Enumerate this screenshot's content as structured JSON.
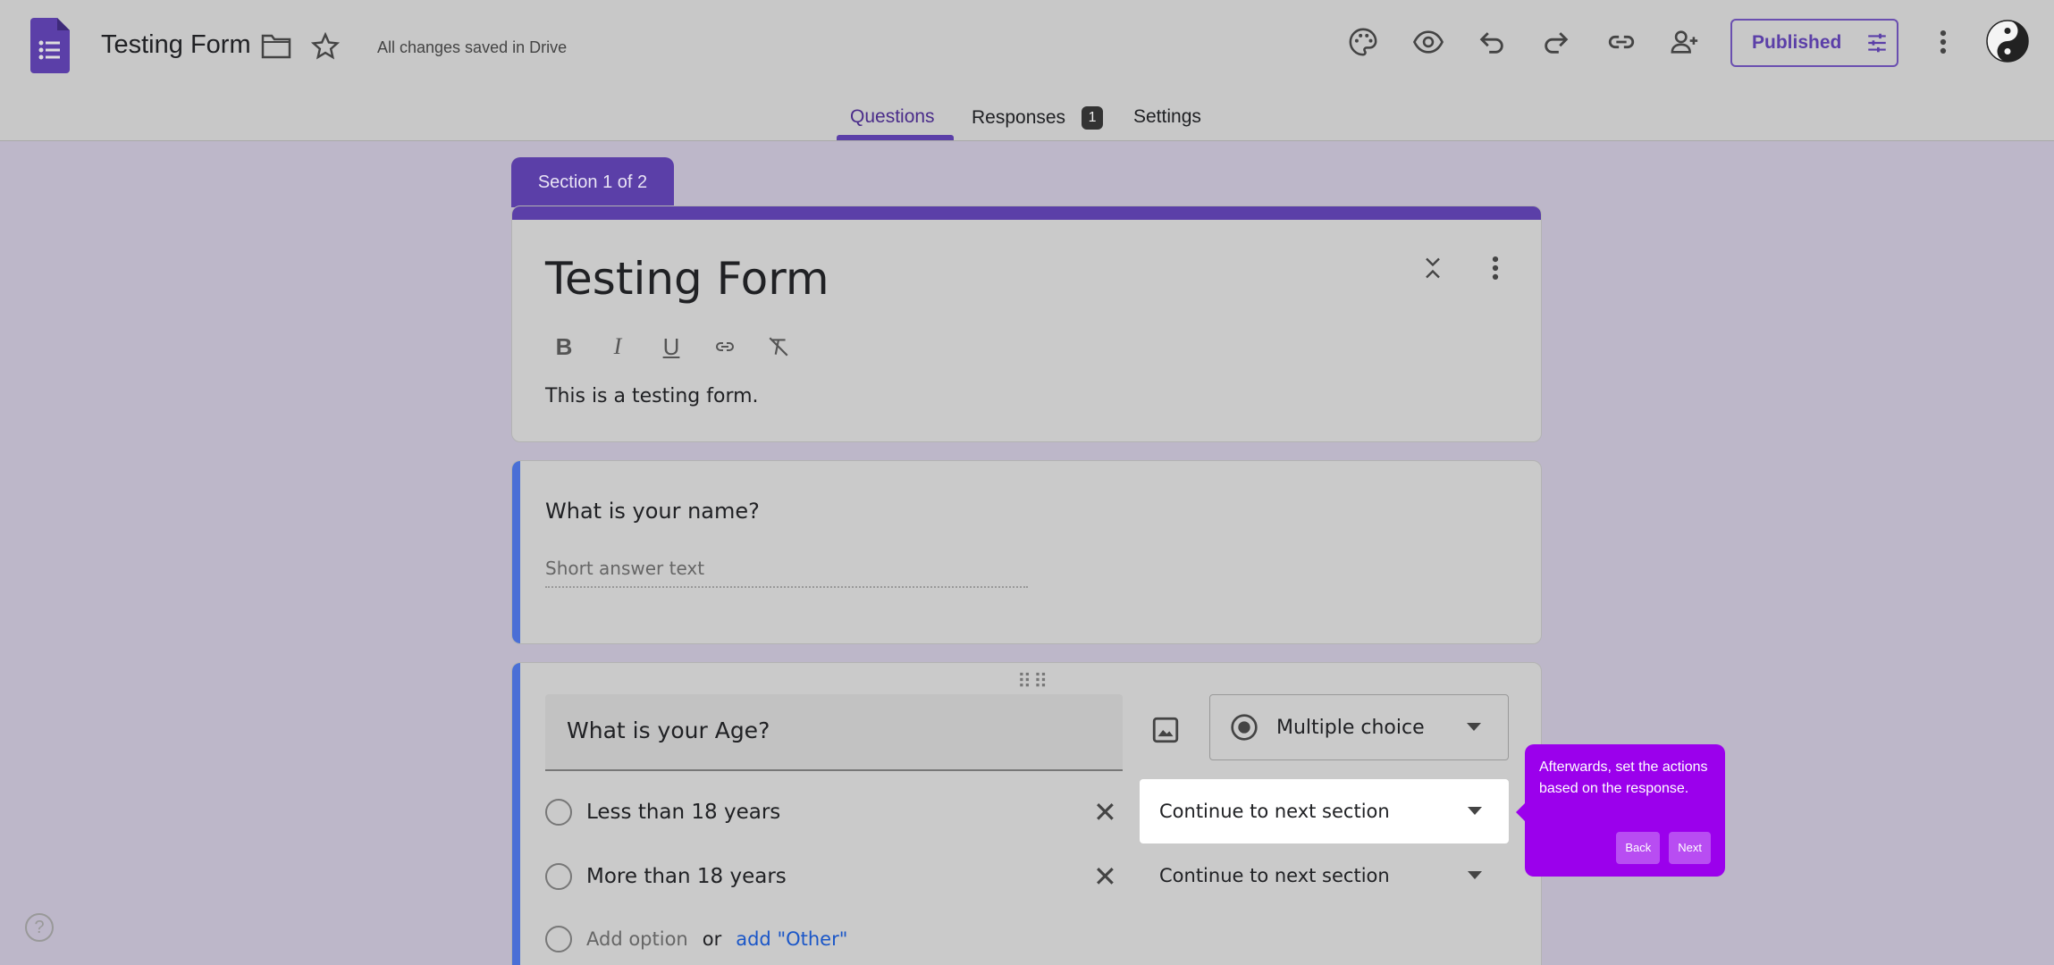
{
  "header": {
    "doc_title": "Testing Form",
    "saved_status": "All changes saved in Drive",
    "publish_label": "Published",
    "icons": [
      "folder-icon",
      "star-icon",
      "palette-icon",
      "eye-icon",
      "undo-icon",
      "redo-icon",
      "link-icon",
      "add-person-icon",
      "tune-icon",
      "more-vert-icon"
    ]
  },
  "tabs": [
    {
      "label": "Questions",
      "active": true
    },
    {
      "label": "Responses",
      "badge": "1"
    },
    {
      "label": "Settings"
    }
  ],
  "section": {
    "tag": "Section 1 of 2",
    "title": "Testing Form",
    "description": "This is a testing form."
  },
  "question1": {
    "title": "What is your name?",
    "placeholder": "Short answer text"
  },
  "question2": {
    "title": "What is your Age?",
    "type": "Multiple choice",
    "options": [
      {
        "label": "Less than 18 years",
        "goto": "Continue to next section"
      },
      {
        "label": "More than 18 years",
        "goto": "Continue to next section"
      }
    ],
    "add_option": "Add option",
    "or": "or",
    "add_other": "add \"Other\""
  },
  "tooltip": {
    "text": "Afterwards, set the actions based on the response.",
    "back": "Back",
    "next": "Next"
  },
  "colors": {
    "brand": "#5b3fa8",
    "accent_blue": "#4a6fd6",
    "tooltip": "#9b00ec"
  }
}
